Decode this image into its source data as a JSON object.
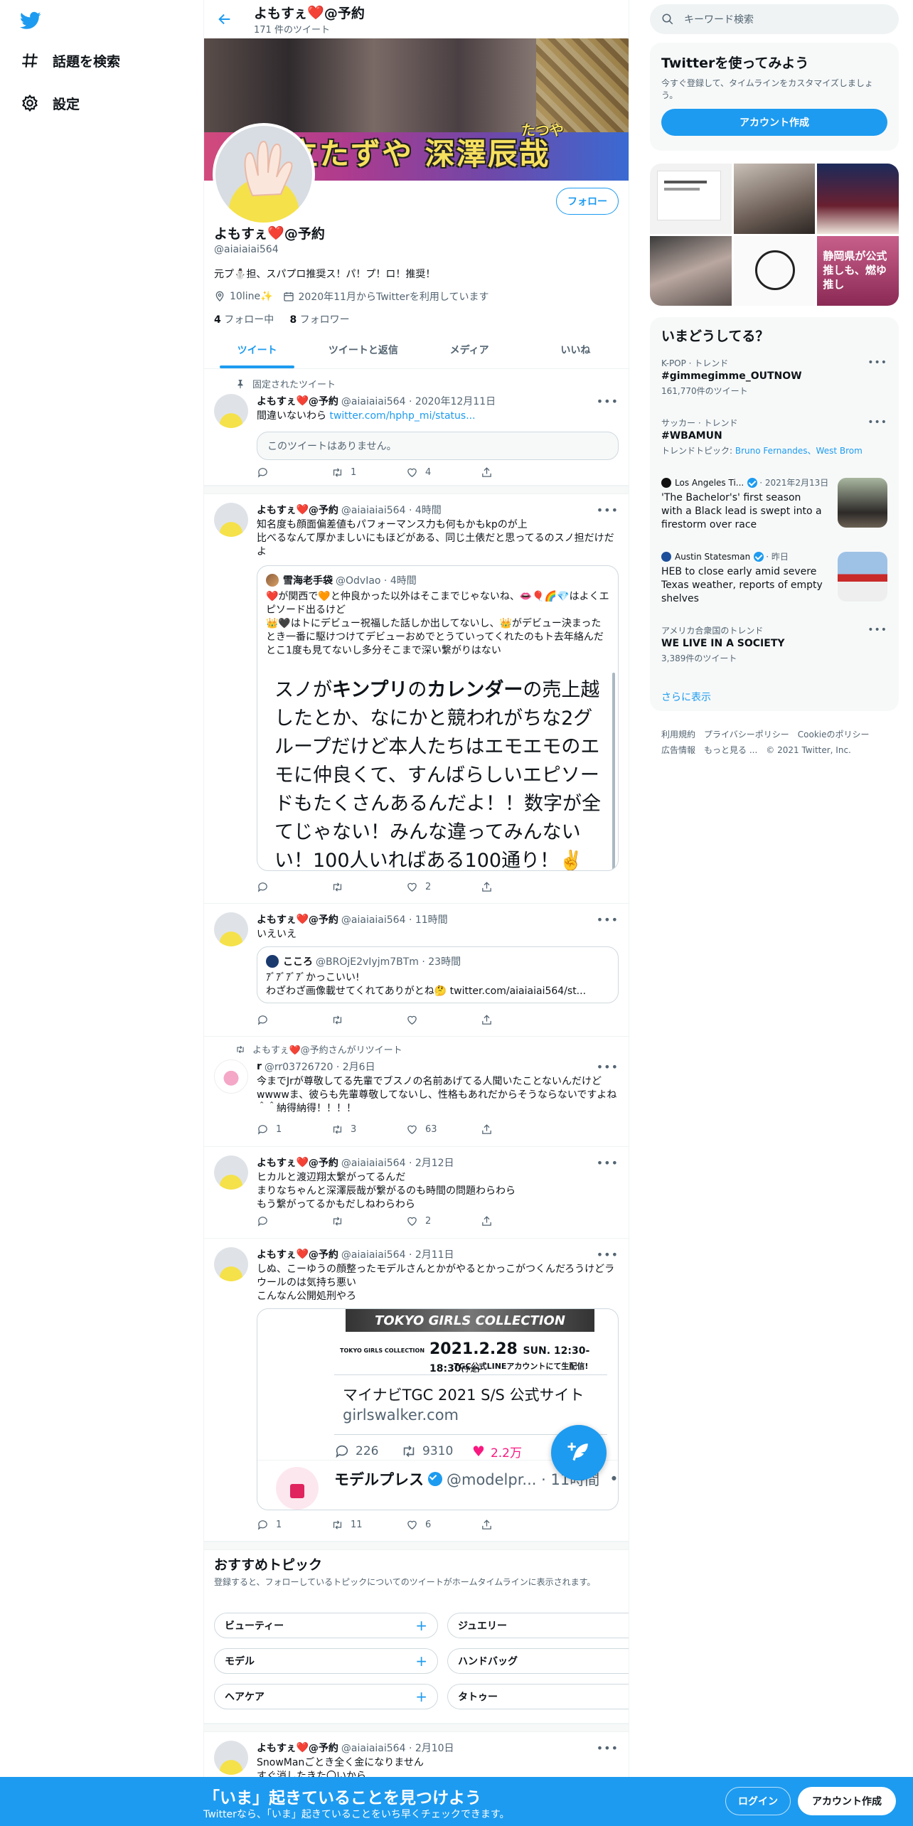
{
  "nav": {
    "explore_label": "話題を検索",
    "settings_label": "設定"
  },
  "header": {
    "name": "よもすぇ",
    "suffix": "@予約",
    "tweet_count": "171 件のツイート"
  },
  "banner": {
    "caption": "立たずや 深澤辰哉",
    "ruby": "たつや"
  },
  "profile": {
    "follow_label": "フォロー",
    "name": "よもすぇ",
    "name_suffix": "@予約",
    "handle": "@aiaiaiai564",
    "bio": "元プ⛄担、スパプロ推奨ス！パ！プ！ロ！推奨！",
    "location": "10line✨",
    "joined": "2020年11月からTwitterを利用しています",
    "following_count": "4",
    "following_label": "フォロー中",
    "followers_count": "8",
    "followers_label": "フォロワー"
  },
  "tabs": [
    "ツイート",
    "ツイートと返信",
    "メディア",
    "いいね"
  ],
  "tweets": {
    "pinned_label": "固定されたツイート",
    "t1": {
      "name": "よもすぇ",
      "suffix": "@予約",
      "meta": "@aiaiaiai564 · 2020年12月11日",
      "text": "間違いないわら ",
      "link": "twitter.com/hphp_mi/status...",
      "quote_unavailable": "このツイートはありません。",
      "retweets": "1",
      "likes": "4"
    },
    "t2": {
      "name": "よもすぇ",
      "suffix": "@予約",
      "meta": "@aiaiaiai564 · 4時間",
      "text": "知名度も顔面偏差値もパフォーマンス力も何もかもkpのが上\n比べるなんて厚かましいにもほどがある、同じ土俵だと思ってるのスノ担だけだよ",
      "q_name": "雪海老手袋",
      "q_meta": "@OdvIao · 4時間",
      "q_text": "❤️が関西で🧡と仲良かった以外はそこまでじゃないね、👄🎈🌈💎はよくエピソード出るけど\n👑🖤はトにデビュー祝福した話しか出してないし、👑がデビュー決まったとき一番に駆けつけてデビューおめでとうていってくれたのもト去年絡んだとこ1度も見てないし多分そこまで深い繋がりはない",
      "big_text_1": "スノが",
      "big_b1": "キンプリ",
      "big_text_2": "の",
      "big_b2": "カレンダー",
      "big_text_3": "の売上越したとか、なにかと競われがちな2グループだけど本人たちはエモエモのエモに仲良くて、すんばらしいエピソードもたくさんあるんだよ！！数字が全てじゃない！みんな違ってみんないい！100人いればある100通り！✌️",
      "likes": "2"
    },
    "t3": {
      "name": "よもすぇ",
      "suffix": "@予約",
      "meta": "@aiaiaiai564 · 11時間",
      "text": "いえいえ",
      "q_name": "こころ",
      "q_meta": "@BROjE2vIyjm7BTm · 23時間",
      "q_text": "ｱﾞｱﾞｱﾞｱﾞかっこいい!\nわざわざ画像載せてくれてありがとね🤔 ",
      "q_link": "twitter.com/aiaiaiai564/st..."
    },
    "t4": {
      "rt_label": "よもすぇ❤️@予約さんがリツイート",
      "name": "r",
      "meta": "@rr03726720 · 2月6日",
      "text": "今までJrが尊敬してる先輩でブスノの名前あげてる人聞いたことないんだけどwwwwま、彼らも先輩尊敬してないし、性格もあれだからそうならないですよね＾＾納得納得！！！！",
      "replies": "1",
      "retweets": "3",
      "likes": "63"
    },
    "t5": {
      "name": "よもすぇ",
      "suffix": "@予約",
      "meta": "@aiaiaiai564 · 2月12日",
      "text": "ヒカルと渡辺翔太繋がってるんだ\nまりなちゃんと深澤辰哉が繋がるのも時間の問題わらわら\nもう繋がってるかもだしねわらわら",
      "likes": "2"
    },
    "t6": {
      "name": "よもすぇ",
      "suffix": "@予約",
      "meta": "@aiaiaiai564 · 2月11日",
      "text": "しぬ、こーゆうの顔整ったモデルさんとかがやるとかっこがつくんだろうけどラウールのは気持ち悪い\nこんなん公開処刑やろ",
      "card_banner": "TOKYO GIRLS COLLECTION",
      "card_date": "2021.2.28",
      "card_time": "SUN. 12:30-18:30",
      "card_time_note": "(予定)",
      "card_line": "TGC公式LINEアカウントにて生配信!",
      "card_brand": "TOKYO GIRLS COLLECTION",
      "card_title": "マイナビTGC 2021 S/S 公式サイト",
      "card_domain": "girlswalker.com",
      "inner_replies": "226",
      "inner_retweets": "9310",
      "inner_likes": "2.2万",
      "next_name": "モデルプレス",
      "next_meta": "@modelpr... · 11時間",
      "replies": "1",
      "retweets": "11",
      "likes": "6"
    },
    "t7": {
      "name": "よもすぇ",
      "suffix": "@予約",
      "meta": "@aiaiaiai564 · 2月10日",
      "text": "SnowManごとき全く金になりません\nすぐ消したきた〇いから"
    }
  },
  "topics": {
    "title": "おすすめトピック",
    "sub": "登録すると、フォローしているトピックについてのツイートがホームタイムラインに表示されます。",
    "items": [
      "ビューティー",
      "ジュエリー",
      "モデル",
      "ハンドバッグ",
      "ヘアケア",
      "タトゥー"
    ]
  },
  "right": {
    "search_placeholder": "キーワード検索",
    "signup_title": "Twitterを使ってみよう",
    "signup_sub": "今すぐ登録して、タイムラインをカスタマイズしましょう。",
    "signup_button": "アカウント作成",
    "media_text": "静岡県が公式 推しも、燃ゆ 推し",
    "trends_title": "いまどうしてる？",
    "trends": [
      {
        "context": "K-POP · トレンド",
        "name": "#gimmegimme_OUTNOW",
        "extra": "161,770件のツイート"
      },
      {
        "context": "サッカー · トレンド",
        "name": "#WBAMUN",
        "extra_prefix": "トレンドトピック: ",
        "extra_links": "Bruno Fernandes、West Brom"
      },
      {
        "context": "アメリカ合衆国のトレンド",
        "name": "WE LIVE IN A SOCIETY",
        "extra": "3,389件のツイート"
      }
    ],
    "news": [
      {
        "source": "Los Angeles Ti...",
        "time": "· 2021年2月13日",
        "headline": "'The Bachelor's' first season with a Black lead is swept into a firestorm over race"
      },
      {
        "source": "Austin Statesman",
        "time": "· 昨日",
        "headline": "HEB to close early amid severe Texas weather, reports of empty shelves"
      }
    ],
    "more_label": "さらに表示",
    "footer": [
      "利用規約",
      "プライバシーポリシー",
      "Cookieのポリシー",
      "広告情報",
      "もっと見る ...",
      "© 2021 Twitter, Inc."
    ]
  },
  "bottom": {
    "title": "「いま」起きていることを見つけよう",
    "sub": "Twitterなら、「いま」起きていることをいち早くチェックできます。",
    "login": "ログイン",
    "signup": "アカウント作成"
  },
  "colors": {
    "accent": "#1d9bf0",
    "like": "#f91880",
    "heart": "#e0245e"
  }
}
